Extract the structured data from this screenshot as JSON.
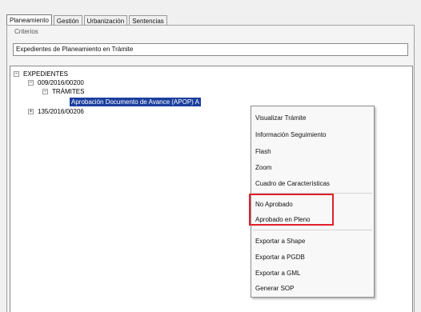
{
  "tabs": [
    {
      "label": "Planeamiento",
      "active": true
    },
    {
      "label": "Gestión",
      "active": false
    },
    {
      "label": "Urbanización",
      "active": false
    },
    {
      "label": "Sentencias",
      "active": false
    }
  ],
  "criteria": {
    "legend": "Criterios",
    "value": "Expedientes de Planeamiento en Trámite"
  },
  "tree": {
    "root": {
      "label": "EXPEDIENTES",
      "expander": "−"
    },
    "expediente_1": {
      "label": "009/2016/00200",
      "expander": "−"
    },
    "tramites": {
      "label": "TRÁMITES",
      "expander": "−"
    },
    "selected_item": {
      "label": "Aprobación Documento de Avance (APOP) A"
    },
    "expediente_2": {
      "label": "135/2016/00206",
      "expander": "+"
    }
  },
  "context_menu": {
    "items": [
      "Visualizar Trámite",
      "Información Seguimiento",
      "Flash",
      "Zoom",
      "Cuadro de Características",
      "No Aprobado",
      "Aprobado en Pleno",
      "Exportar a Shape",
      "Exportar a PGDB",
      "Exportar a GML",
      "Generar SOP"
    ]
  },
  "colors": {
    "selection": "#1c3f9e",
    "highlight_border": "#e0202a"
  }
}
